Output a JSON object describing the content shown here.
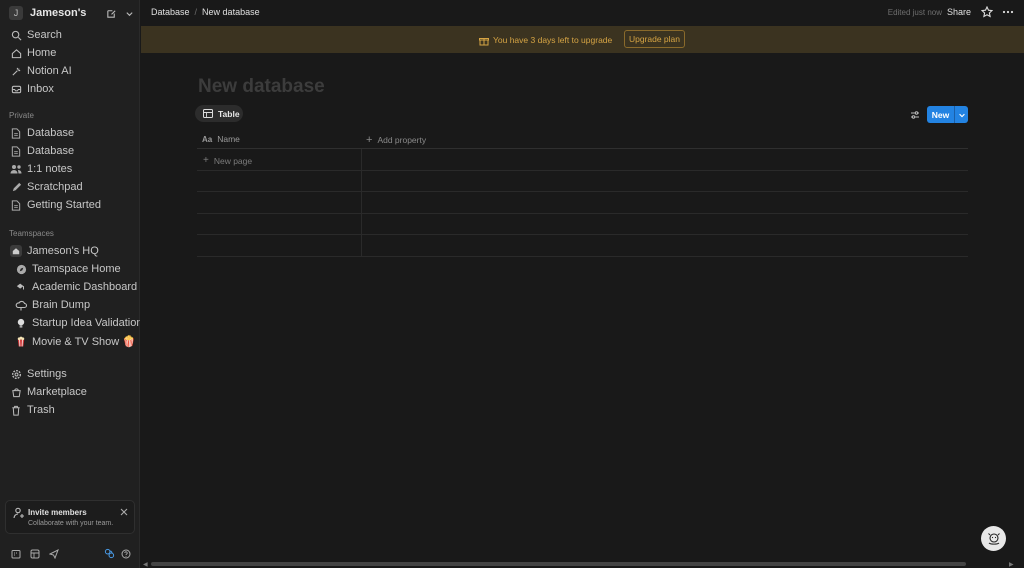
{
  "workspace": {
    "name": "Jameson's",
    "avatar_letter": "J"
  },
  "sidebar": {
    "top_items": [
      {
        "label": "Search",
        "icon": "search-icon"
      },
      {
        "label": "Home",
        "icon": "home-icon"
      },
      {
        "label": "Notion AI",
        "icon": "notion-ai-icon"
      },
      {
        "label": "Inbox",
        "icon": "inbox-icon"
      }
    ],
    "private_label": "Private",
    "private_items": [
      {
        "label": "Database",
        "icon": "page-icon"
      },
      {
        "label": "Database",
        "icon": "page-icon"
      },
      {
        "label": "1:1 notes",
        "icon": "people-icon"
      },
      {
        "label": "Scratchpad",
        "icon": "pencil-icon"
      },
      {
        "label": "Getting Started",
        "icon": "page-icon"
      }
    ],
    "teamspaces_label": "Teamspaces",
    "teamspace_name": "Jameson's HQ",
    "teamspace_items": [
      {
        "label": "Teamspace Home",
        "icon": "compass-icon"
      },
      {
        "label": "Academic Dashboard",
        "icon": "graduation-icon"
      },
      {
        "label": "Brain Dump",
        "icon": "cloud-icon"
      },
      {
        "label": "Startup Idea Validation D...",
        "icon": "lightbulb-icon"
      },
      {
        "label": "Movie & TV Show 🍿",
        "icon": "popcorn-icon"
      }
    ],
    "bottom_items": [
      {
        "label": "Settings",
        "icon": "gear-icon"
      },
      {
        "label": "Marketplace",
        "icon": "marketplace-icon"
      },
      {
        "label": "Trash",
        "icon": "trash-icon"
      }
    ],
    "invite": {
      "title": "Invite members",
      "subtitle": "Collaborate with your team."
    }
  },
  "topbar": {
    "breadcrumb": [
      "Database",
      "New database"
    ],
    "edited": "Edited just now",
    "share": "Share"
  },
  "banner": {
    "text": "You have 3 days left to upgrade",
    "button": "Upgrade plan",
    "color": "#d6a444"
  },
  "main": {
    "title": "New database",
    "view_tab": "Table",
    "new_button": "New",
    "columns": {
      "name": "Name",
      "name_icon": "Aa",
      "add_property": "Add property"
    },
    "new_page": "New page"
  },
  "colors": {
    "accent": "#2383e2",
    "background": "#191919",
    "sidebar": "#202020"
  }
}
